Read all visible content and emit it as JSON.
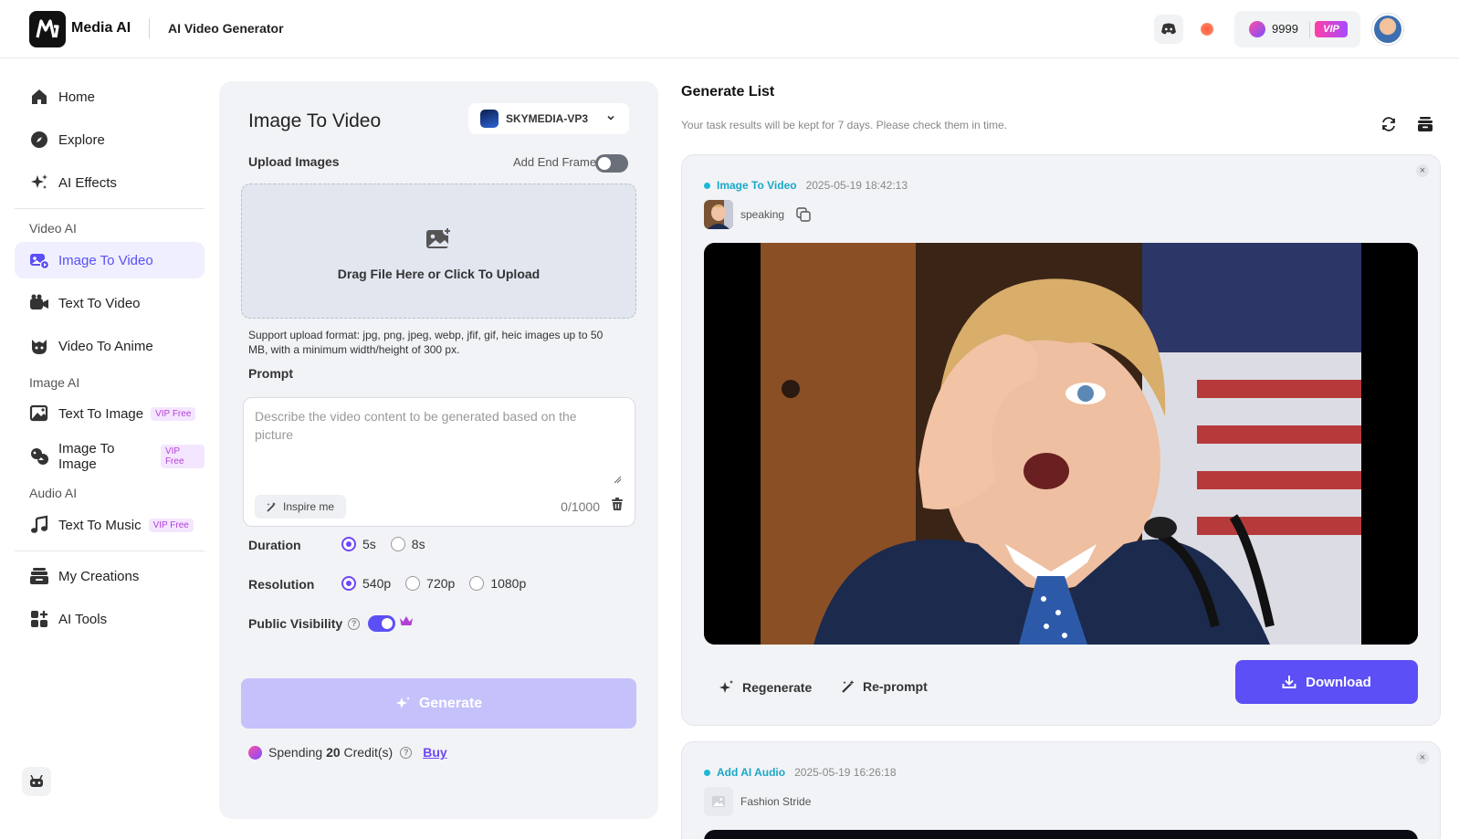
{
  "header": {
    "brand": "Media AI",
    "page_name": "AI Video Generator",
    "credits": "9999",
    "vip_label": "VIP"
  },
  "sidebar": {
    "items": [
      {
        "label": "Home",
        "icon": "home-icon"
      },
      {
        "label": "Explore",
        "icon": "compass-icon"
      },
      {
        "label": "AI Effects",
        "icon": "sparkles-icon"
      }
    ],
    "sections": {
      "video_ai": "Video AI",
      "image_ai": "Image AI",
      "audio_ai": "Audio AI"
    },
    "video_items": [
      {
        "label": "Image To Video",
        "icon": "image-video-icon",
        "active": true
      },
      {
        "label": "Text To Video",
        "icon": "video-camera-icon"
      },
      {
        "label": "Video To Anime",
        "icon": "anime-face-icon"
      }
    ],
    "image_items": [
      {
        "label": "Text To Image",
        "badge": "VIP Free",
        "icon": "picture-icon"
      },
      {
        "label": "Image To Image",
        "badge": "VIP Free",
        "icon": "image-transform-icon"
      }
    ],
    "audio_items": [
      {
        "label": "Text To Music",
        "badge": "VIP Free",
        "icon": "music-note-icon"
      }
    ],
    "bottom_items": [
      {
        "label": "My Creations",
        "icon": "stack-icon"
      },
      {
        "label": "AI Tools",
        "icon": "grid-plus-icon"
      }
    ]
  },
  "panel": {
    "title": "Image To Video",
    "model": "SKYMEDIA-VP3",
    "upload_label": "Upload Images",
    "end_frame_label": "Add End Frame",
    "end_frame_enabled": false,
    "upload_text": "Drag File Here or Click To Upload",
    "support_text": "Support upload format: jpg, png, jpeg, webp, jfif, gif, heic images up to 50 MB, with a minimum width/height of 300 px.",
    "prompt_label": "Prompt",
    "prompt_placeholder": "Describe the video content to be generated based on the picture",
    "prompt_value": "",
    "inspire_label": "Inspire me",
    "counter": "0/1000",
    "duration_label": "Duration",
    "duration_options": [
      "5s",
      "8s"
    ],
    "duration_selected": "5s",
    "resolution_label": "Resolution",
    "resolution_options": [
      "540p",
      "720p",
      "1080p"
    ],
    "resolution_selected": "540p",
    "visibility_label": "Public Visibility",
    "visibility_enabled": true,
    "generate_label": "Generate",
    "spending_prefix": "Spending",
    "spending_amount": "20",
    "spending_suffix": "Credit(s)",
    "buy_label": "Buy"
  },
  "generate_list": {
    "title": "Generate List",
    "subtitle": "Your task results will be kept for 7 days. Please check them in time.",
    "tasks": [
      {
        "type": "Image To Video",
        "time": "2025-05-19 18:42:13",
        "prompt": "speaking"
      },
      {
        "type": "Add AI Audio",
        "time": "2025-05-19 16:26:18",
        "prompt": "Fashion Stride"
      }
    ],
    "regenerate_label": "Regenerate",
    "reprompt_label": "Re-prompt",
    "download_label": "Download"
  },
  "colors": {
    "accent": "#5b4ff5",
    "accent_light": "#c5c1fa",
    "task_type": "#19a8c8",
    "vip": "#b340d6"
  }
}
